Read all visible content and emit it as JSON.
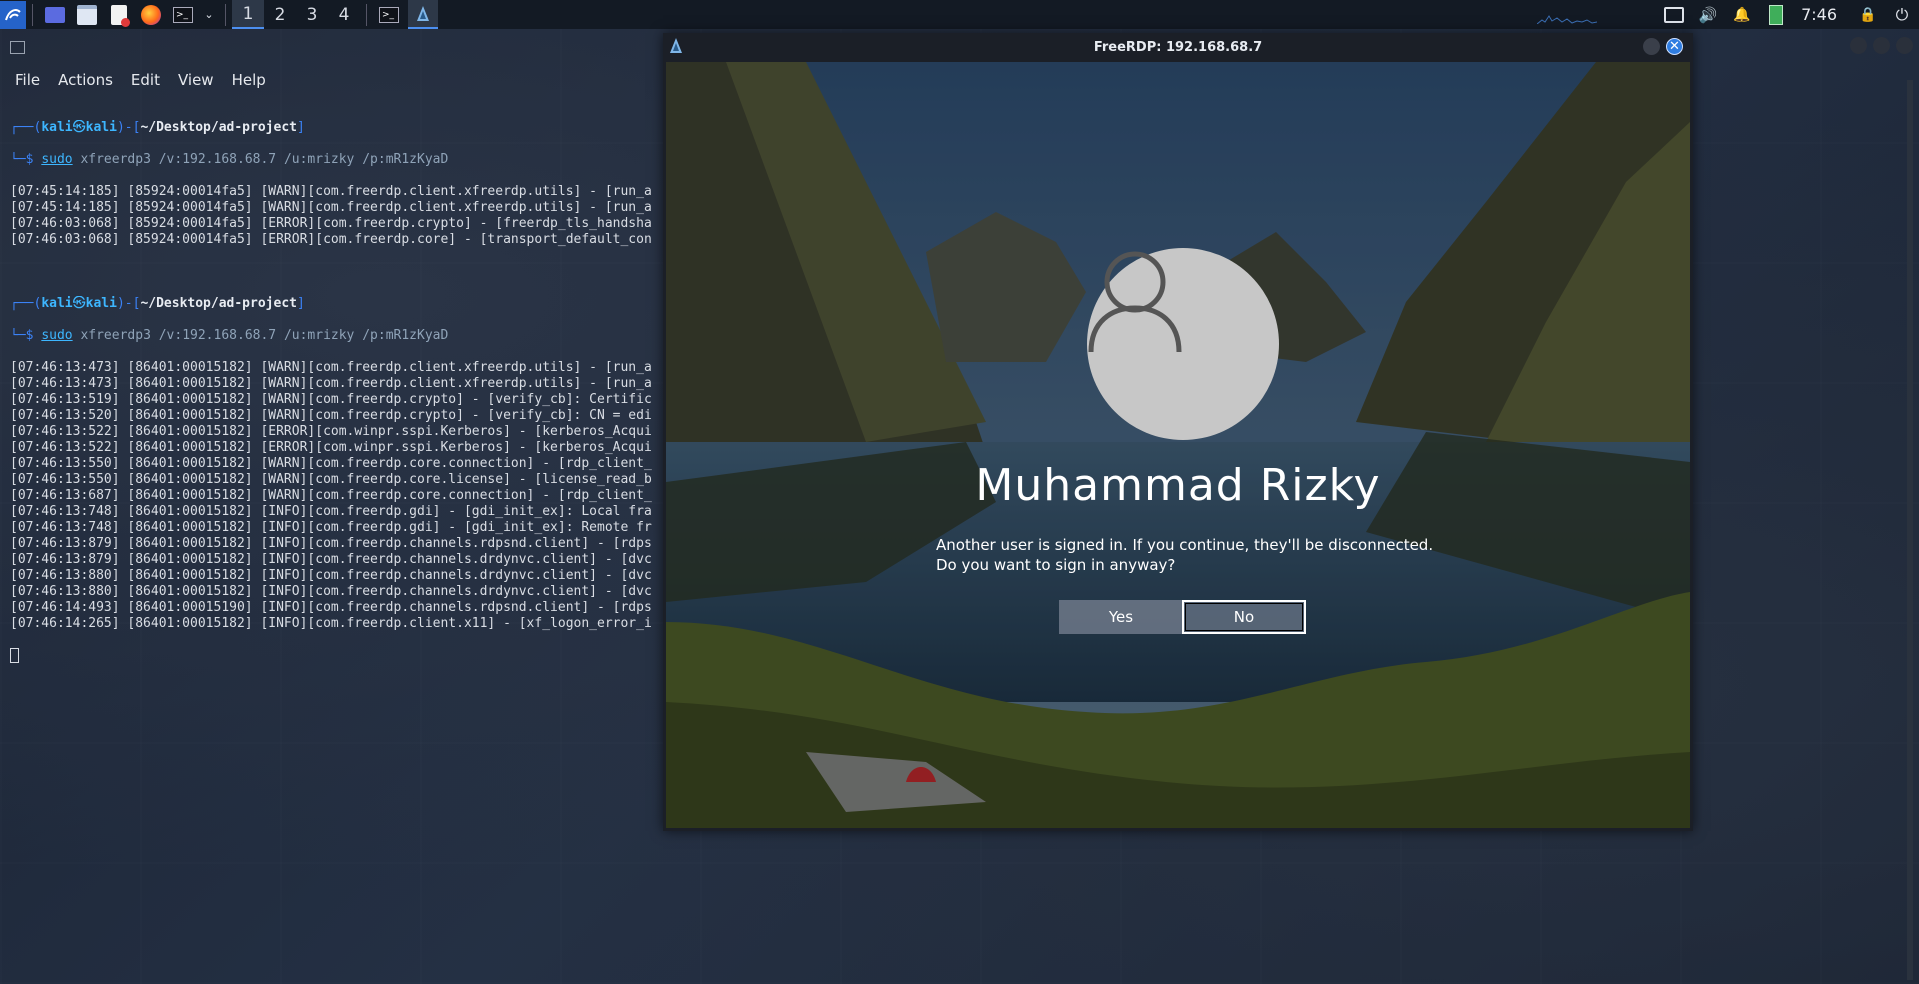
{
  "panel": {
    "workspaces": [
      "1",
      "2",
      "3",
      "4"
    ],
    "active_workspace": "1",
    "clock": "7:46",
    "launcher_icons": [
      "kali-menu-icon",
      "desktop-icon",
      "file-manager-icon",
      "text-editor-icon",
      "firefox-icon",
      "terminal-icon",
      "dropdown-chevron-icon"
    ],
    "tray_icons": [
      "display-icon",
      "volume-icon",
      "notification-bell-icon",
      "battery-icon",
      "lock-icon",
      "logout-icon"
    ]
  },
  "terminal": {
    "menu": [
      "File",
      "Actions",
      "Edit",
      "View",
      "Help"
    ],
    "prompt_user": "kali",
    "prompt_host": "kali",
    "prompt_path": "~/Desktop/ad-project",
    "cmd1": {
      "sudo": "sudo",
      "rest": "xfreerdp3 /v:192.168.68.7 /u:mrizky /p:mR1zKyaD"
    },
    "block1": [
      "[07:45:14:185] [85924:00014fa5] [WARN][com.freerdp.client.xfreerdp.utils] - [run_a",
      "[07:45:14:185] [85924:00014fa5] [WARN][com.freerdp.client.xfreerdp.utils] - [run_a",
      "[07:46:03:068] [85924:00014fa5] [ERROR][com.freerdp.crypto] - [freerdp_tls_handsha",
      "[07:46:03:068] [85924:00014fa5] [ERROR][com.freerdp.core] - [transport_default_con"
    ],
    "cmd2": {
      "sudo": "sudo",
      "rest": "xfreerdp3 /v:192.168.68.7 /u:mrizky /p:mR1zKyaD"
    },
    "block2": [
      "[07:46:13:473] [86401:00015182] [WARN][com.freerdp.client.xfreerdp.utils] - [run_a",
      "[07:46:13:473] [86401:00015182] [WARN][com.freerdp.client.xfreerdp.utils] - [run_a",
      "[07:46:13:519] [86401:00015182] [WARN][com.freerdp.crypto] - [verify_cb]: Certific",
      "[07:46:13:520] [86401:00015182] [WARN][com.freerdp.crypto] - [verify_cb]: CN = edi",
      "[07:46:13:522] [86401:00015182] [ERROR][com.winpr.sspi.Kerberos] - [kerberos_Acqui",
      "[07:46:13:522] [86401:00015182] [ERROR][com.winpr.sspi.Kerberos] - [kerberos_Acqui",
      "[07:46:13:550] [86401:00015182] [WARN][com.freerdp.core.connection] - [rdp_client_",
      "[07:46:13:550] [86401:00015182] [WARN][com.freerdp.core.license] - [license_read_b",
      "[07:46:13:687] [86401:00015182] [WARN][com.freerdp.core.connection] - [rdp_client_",
      "[07:46:13:748] [86401:00015182] [INFO][com.freerdp.gdi] - [gdi_init_ex]: Local fra",
      "[07:46:13:748] [86401:00015182] [INFO][com.freerdp.gdi] - [gdi_init_ex]: Remote fr",
      "[07:46:13:879] [86401:00015182] [INFO][com.freerdp.channels.rdpsnd.client] - [rdps",
      "[07:46:13:879] [86401:00015182] [INFO][com.freerdp.channels.drdynvc.client] - [dvc",
      "[07:46:13:880] [86401:00015182] [INFO][com.freerdp.channels.drdynvc.client] - [dvc",
      "[07:46:13:880] [86401:00015182] [INFO][com.freerdp.channels.drdynvc.client] - [dvc",
      "[07:46:14:493] [86401:00015190] [INFO][com.freerdp.channels.rdpsnd.client] - [rdps",
      "[07:46:14:265] [86401:00015182] [INFO][com.freerdp.client.x11] - [xf_logon_error_i"
    ]
  },
  "rdp": {
    "title": "FreeRDP: 192.168.68.7",
    "username": "Muhammad Rizky",
    "message": "Another user is signed in. If you continue, they'll be disconnected. Do you want to sign in anyway?",
    "yes_label": "Yes",
    "no_label": "No"
  }
}
